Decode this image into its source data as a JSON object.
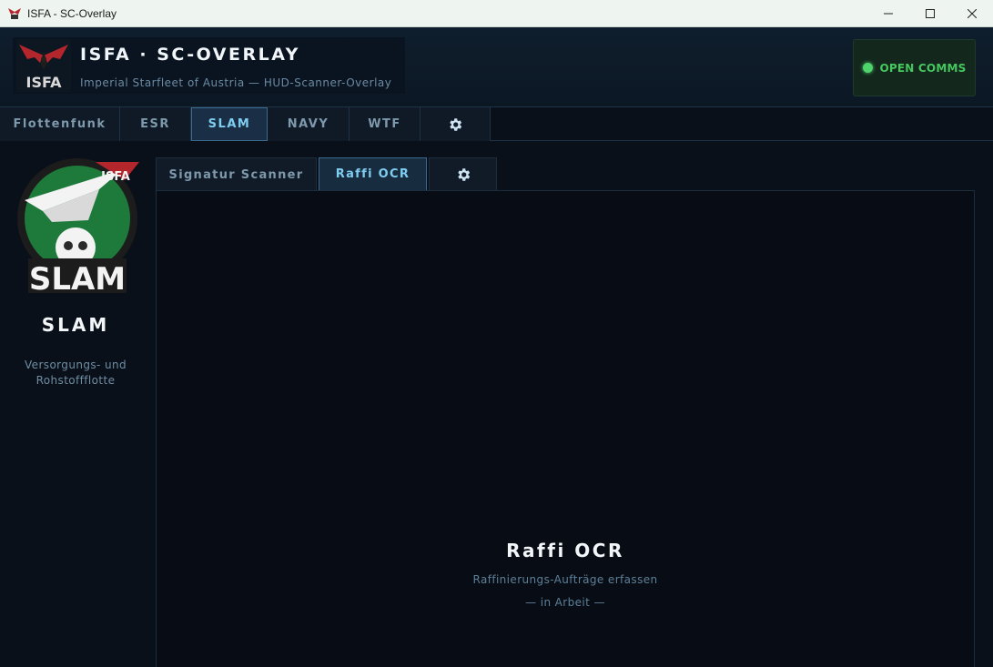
{
  "window": {
    "title": "ISFA - SC-Overlay",
    "minimize_icon": "minimize-icon",
    "maximize_icon": "maximize-icon",
    "close_icon": "close-icon"
  },
  "header": {
    "logo_text": "ISFA",
    "title": "ISFA · SC-OVERLAY",
    "subtitle": "Imperial Starfleet of Austria — HUD-Scanner-Overlay",
    "comms_label": "OPEN COMMS",
    "comms_status_color": "#4fd36b"
  },
  "main_tabs": [
    {
      "label": "Flottenfunk",
      "active": false
    },
    {
      "label": "ESR",
      "active": false
    },
    {
      "label": "SLAM",
      "active": true
    },
    {
      "label": "NAVY",
      "active": false
    },
    {
      "label": "WTF",
      "active": false
    },
    {
      "label": "",
      "icon": "gear-icon",
      "active": false
    }
  ],
  "sidebar": {
    "logo_badge": "ISFA",
    "logo_text": "SLAM",
    "name": "SLAM",
    "description_line1": "Versorgungs- und",
    "description_line2": "Rohstoffflotte"
  },
  "sub_tabs": [
    {
      "label": "Signatur Scanner",
      "active": false
    },
    {
      "label": "Raffi OCR",
      "active": true
    },
    {
      "label": "",
      "icon": "gear-icon",
      "active": false
    }
  ],
  "panel": {
    "title": "Raffi OCR",
    "subtitle": "Raffinierungs-Aufträge erfassen",
    "status": "— in Arbeit —"
  },
  "colors": {
    "accent": "#7fcdf0",
    "background": "#0a1019",
    "comms_green": "#46c75e"
  }
}
